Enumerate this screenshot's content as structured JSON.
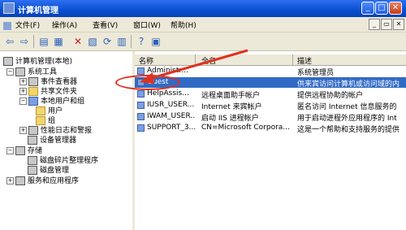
{
  "window": {
    "title": "计算机管理"
  },
  "menubar": {
    "items": [
      "文件(F)",
      "操作(A)",
      "查看(V)",
      "窗口(W)",
      "帮助(H)"
    ]
  },
  "tree": {
    "root": "计算机管理(本地)",
    "system_tools": "系统工具",
    "event_viewer": "事件查看器",
    "shared_folders": "共享文件夹",
    "local_users_groups": "本地用户和组",
    "users": "用户",
    "groups": "组",
    "perf_logs": "性能日志和警报",
    "device_manager": "设备管理器",
    "storage": "存储",
    "defrag": "磁盘碎片整理程序",
    "disk_mgmt": "磁盘管理",
    "services_apps": "服务和应用程序"
  },
  "list": {
    "headers": {
      "name": "名称",
      "fullname": "全名",
      "desc": "描述"
    },
    "rows": [
      {
        "name": "Administr...",
        "fullname": "",
        "desc": "系统管理员"
      },
      {
        "name": "Guest",
        "fullname": "",
        "desc": "供来宾访问计算机或访问域的内"
      },
      {
        "name": "HelpAssis...",
        "fullname": "远程桌面助手帐户",
        "desc": "提供远程协助的帐户"
      },
      {
        "name": "IUSR_USER...",
        "fullname": "Internet 来宾帐户",
        "desc": "匿名访问 Internet 信息服务的"
      },
      {
        "name": "IWAM_USER...",
        "fullname": "启动 IIS 进程帐户",
        "desc": "用于启动进程外应用程序的 Int"
      },
      {
        "name": "SUPPORT_3...",
        "fullname": "CN=Microsoft Corpora...",
        "desc": "这是一个帮助和支持服务的提供"
      }
    ]
  }
}
